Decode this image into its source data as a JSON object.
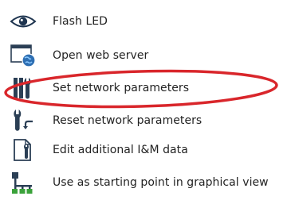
{
  "menu": {
    "items": [
      {
        "label": "Flash LED",
        "icon": "eye-icon"
      },
      {
        "label": "Open web server",
        "icon": "web-server-icon"
      },
      {
        "label": "Set network parameters",
        "icon": "network-parameters-icon"
      },
      {
        "label": "Reset network parameters",
        "icon": "reset-network-icon"
      },
      {
        "label": "Edit additional I&M data",
        "icon": "edit-im-data-icon"
      },
      {
        "label": "Use as starting point in graphical view",
        "icon": "graphical-view-icon"
      }
    ]
  },
  "highlight": {
    "target": "Set network parameters",
    "color": "#d9262b"
  }
}
